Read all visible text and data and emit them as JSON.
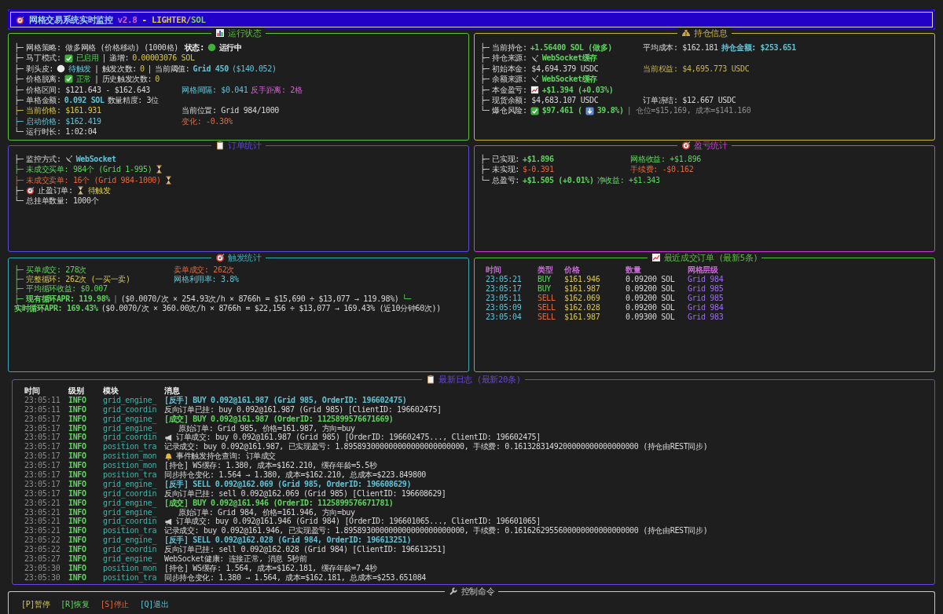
{
  "header": {
    "title": "网格交易系统实时监控",
    "version": "v2.8",
    "separator": "-",
    "exchange": "LIGHTER/",
    "symbol": "SOL"
  },
  "rows": [
    [
      {
        "kind": "tree",
        "color": "#5cbf3c",
        "title": [
          {
            "kind": "bar-chart-icon"
          },
          {
            "kind": "title",
            "text": "运行状态"
          }
        ],
        "lines": [
          {
            "branch": "├─",
            "cells": [
              [
                {
                  "kind": "label",
                  "text": "网格策略: 做多网格 (价格移动) (1000格)"
                }
              ],
              [
                {
                  "kind": "bold",
                  "text": "状态:"
                },
                {
                  "kind": "status-light-icon"
                },
                {
                  "kind": "bold",
                  "text": "运行中"
                }
              ]
            ]
          },
          {
            "branch": "├─",
            "cells": [
              [
                {
                  "kind": "label",
                  "text": "马丁模式:"
                },
                {
                  "kind": "check-icon"
                },
                {
                  "kind": "green",
                  "text": "已启用"
                },
                {
                  "kind": "sep",
                  "text": "|"
                },
                {
                  "kind": "label",
                  "text": "递增:"
                },
                {
                  "kind": "yellow",
                  "text": "0.00003076 SOL"
                }
              ]
            ]
          },
          {
            "branch": "├─",
            "cells": [
              [
                {
                  "kind": "label",
                  "text": "剥头皮:"
                },
                {
                  "kind": "circle-icon"
                },
                {
                  "kind": "cyan",
                  "text": "待触发"
                },
                {
                  "kind": "sep",
                  "text": "|"
                },
                {
                  "kind": "label",
                  "text": "触发次数:"
                },
                {
                  "kind": "yellow",
                  "text": "0"
                },
                {
                  "kind": "sep",
                  "text": "|"
                },
                {
                  "kind": "label",
                  "text": "当前阈值:"
                },
                {
                  "kind": "bcyan",
                  "text": "Grid 450"
                },
                {
                  "kind": "cyan",
                  "text": "($140.052)"
                }
              ]
            ]
          },
          {
            "branch": "├─",
            "cells": [
              [
                {
                  "kind": "label",
                  "text": "价格脱离:"
                },
                {
                  "kind": "check-icon"
                },
                {
                  "kind": "green",
                  "text": "正常"
                },
                {
                  "kind": "sep",
                  "text": "|"
                },
                {
                  "kind": "label",
                  "text": "历史触发次数:"
                },
                {
                  "kind": "yellow",
                  "text": "0"
                }
              ]
            ]
          },
          {
            "branch": "├─",
            "cells": [
              [
                {
                  "kind": "label",
                  "text": "价格区间: $121.643 - $162.643"
                }
              ],
              [
                {
                  "kind": "cyan",
                  "text": "网格间隔: $0.041"
                },
                {
                  "kind": "magenta",
                  "text": "反手距离: 2格"
                }
              ]
            ]
          },
          {
            "branch": "├─",
            "cells": [
              [
                {
                  "kind": "label",
                  "text": "单格金额:"
                },
                {
                  "kind": "bcyan",
                  "text": "0.092 SOL"
                },
                {
                  "kind": "label",
                  "text": "数量精度: 3位"
                }
              ]
            ]
          },
          {
            "branch": "├─",
            "kind": "yellow",
            "cells": [
              [
                {
                  "kind": "yellow",
                  "text": "当前价格: $161.931"
                }
              ],
              [
                {
                  "kind": "label",
                  "text": "当前位置: Grid 984/1000"
                }
              ]
            ]
          },
          {
            "branch": "├─",
            "kind": "cyan",
            "cells": [
              [
                {
                  "kind": "cyan",
                  "text": "启动价格: $162.419"
                }
              ],
              [
                {
                  "kind": "orange",
                  "text": "变化: -0.30%"
                }
              ]
            ]
          },
          {
            "branch": "└─",
            "cells": [
              [
                {
                  "kind": "label",
                  "text": "运行时长: 1:02:04"
                }
              ]
            ]
          }
        ]
      },
      {
        "kind": "tree",
        "color": "#c8b43c",
        "title": [
          {
            "kind": "money-bag-icon"
          },
          {
            "kind": "title",
            "text": "持仓信息"
          }
        ],
        "lines": [
          {
            "branch": "├─",
            "cells": [
              [
                {
                  "kind": "label",
                  "text": "当前持仓:"
                },
                {
                  "kind": "bgreen",
                  "text": "+1.56400 SOL (做多)"
                }
              ],
              [
                {
                  "kind": "label",
                  "text": "平均成本: $162.181"
                },
                {
                  "kind": "bcyan",
                  "text": "持仓金额: $253.651"
                }
              ]
            ]
          },
          {
            "branch": "├─",
            "cells": [
              [
                {
                  "kind": "label",
                  "text": "持仓来源:"
                },
                {
                  "kind": "satellite-dish-icon"
                },
                {
                  "kind": "bgreen",
                  "text": "WebSocket缓存"
                }
              ]
            ]
          },
          {
            "branch": "├─",
            "cells": [
              [
                {
                  "kind": "label",
                  "text": "初始本金: $4,694.379 USDC"
                }
              ],
              [
                {
                  "kind": "olive",
                  "text": "当前权益: $4,695.773 USDC"
                }
              ]
            ]
          },
          {
            "branch": "├─",
            "cells": [
              [
                {
                  "kind": "label",
                  "text": "余额来源:"
                },
                {
                  "kind": "satellite-dish-icon"
                },
                {
                  "kind": "bgreen",
                  "text": "WebSocket缓存"
                }
              ]
            ]
          },
          {
            "branch": "├─",
            "cells": [
              [
                {
                  "kind": "label",
                  "text": "本金盈亏:"
                },
                {
                  "kind": "line-chart-icon"
                },
                {
                  "kind": "bgreen",
                  "text": "+$1.394 (+0.03%)"
                }
              ]
            ]
          },
          {
            "branch": "├─",
            "cells": [
              [
                {
                  "kind": "label",
                  "text": "现货余额: $4,683.107 USDC"
                }
              ],
              [
                {
                  "kind": "label",
                  "text": "订单冻结: $12.667 USDC"
                }
              ]
            ]
          },
          {
            "branch": "└─",
            "cells": [
              [
                {
                  "kind": "label",
                  "text": "爆仓风险:"
                },
                {
                  "kind": "check-icon"
                },
                {
                  "kind": "bgreen",
                  "text": "$97.461 ("
                },
                {
                  "kind": "down-arrow-icon"
                },
                {
                  "kind": "bgreen",
                  "text": "39.8%)"
                },
                {
                  "kind": "gray",
                  "text": "| 仓位=$15,169, 成本=$141.160"
                }
              ]
            ]
          }
        ]
      }
    ],
    [
      {
        "kind": "tree",
        "color": "#5a4bd6",
        "title": [
          {
            "kind": "clipboard-icon"
          },
          {
            "kind": "title",
            "text": "订单统计"
          }
        ],
        "lines": [
          {
            "branch": "├─",
            "cells": [
              [
                {
                  "kind": "label",
                  "text": "监控方式:"
                },
                {
                  "kind": "satellite-dish-icon"
                },
                {
                  "kind": "bcyan",
                  "text": "WebSocket"
                }
              ]
            ]
          },
          {
            "branch": "├─",
            "kind": "green",
            "cells": [
              [
                {
                  "kind": "green",
                  "text": "未成交买单: 984个 (Grid 1-995)"
                },
                {
                  "kind": "hourglass-icon"
                }
              ]
            ]
          },
          {
            "branch": "├─",
            "kind": "orange",
            "cells": [
              [
                {
                  "kind": "orange",
                  "text": "未成交卖单: 16个 (Grid 984-1000)"
                },
                {
                  "kind": "hourglass-icon"
                }
              ]
            ]
          },
          {
            "branch": "├─",
            "cells": [
              [
                {
                  "kind": "target-icon"
                },
                {
                  "kind": "label",
                  "text": "止盈订单:"
                },
                {
                  "kind": "hourglass-icon"
                },
                {
                  "kind": "yellow",
                  "text": "待触发"
                }
              ]
            ]
          },
          {
            "branch": "└─",
            "cells": [
              [
                {
                  "kind": "label",
                  "text": "总挂单数量: 1000个"
                }
              ]
            ]
          }
        ]
      },
      {
        "kind": "tree",
        "color": "#c040c8",
        "title": [
          {
            "kind": "target-icon"
          },
          {
            "kind": "title",
            "text": "盈亏统计"
          }
        ],
        "lines": [
          {
            "branch": "├─",
            "cells": [
              [
                {
                  "kind": "label",
                  "text": "已实现:"
                },
                {
                  "kind": "bgreen",
                  "text": "+$1.896"
                }
              ],
              [
                {
                  "kind": "green",
                  "text": "网格收益: +$1.896"
                }
              ]
            ]
          },
          {
            "branch": "├─",
            "cells": [
              [
                {
                  "kind": "label",
                  "text": "未实现:"
                },
                {
                  "kind": "orange",
                  "text": "$-0.391"
                }
              ],
              [
                {
                  "kind": "orange",
                  "text": "手续费: -$0.162"
                }
              ]
            ]
          },
          {
            "branch": "└─",
            "cells": [
              [
                {
                  "kind": "label",
                  "text": "总盈亏:"
                },
                {
                  "kind": "bgreen",
                  "text": "+$1.505 (+0.01%)"
                },
                {
                  "kind": "green",
                  "text": "净收益: +$1.343"
                }
              ]
            ]
          }
        ]
      }
    ],
    [
      {
        "kind": "tree",
        "color": "#3ca8b8",
        "title": [
          {
            "kind": "target-icon"
          },
          {
            "kind": "title",
            "text": "触发统计"
          }
        ],
        "lines": [
          {
            "branch": "├─",
            "kind": "green",
            "cells": [
              [
                {
                  "kind": "green",
                  "text": "买单成交: 278次"
                }
              ],
              [
                {
                  "kind": "orange",
                  "text": "卖单成交: 262次"
                }
              ]
            ]
          },
          {
            "branch": "├─",
            "kind": "green",
            "cells": [
              [
                {
                  "kind": "yellow",
                  "text": "完整循环: 262次 (一买一卖)"
                }
              ],
              [
                {
                  "kind": "cyan",
                  "text": "网格利用率: 3.8%"
                }
              ]
            ]
          },
          {
            "branch": "├─",
            "kind": "green",
            "cells": [
              [
                {
                  "kind": "green",
                  "text": "平均循环收益: $0.007"
                }
              ]
            ]
          },
          {
            "branch": "├─",
            "kind": "green",
            "cells": [
              [
                {
                  "kind": "bgreen",
                  "text": "现有循环APR: 119.98%"
                },
                {
                  "kind": "gray",
                  "text": "|"
                },
                {
                  "kind": "label",
                  "text": "($0.0070/次 × 254.93次/h × 8766h = $15,690 ÷ $13,077 → 119.98%)"
                },
                {
                  "kind": "green",
                  "text": "└─"
                }
              ]
            ]
          },
          {
            "cells": [
              [
                {
                  "kind": "bgreen",
                  "text": "实时循环APR: 169.43%"
                },
                {
                  "kind": "label",
                  "text": "($0.0070/次 × 360.00次/h × 8766h = $22,156 ÷ $13,077 → 169.43% (近10分钟60次))"
                }
              ]
            ]
          }
        ]
      },
      {
        "kind": "trades",
        "color": "#5cbf3c",
        "title": [
          {
            "kind": "line-chart-icon"
          },
          {
            "kind": "title",
            "text": "最近成交订单 (最新5条)"
          }
        ],
        "columns": [
          "时间",
          "类型",
          "价格",
          "数量",
          "网格层级"
        ],
        "rows": [
          {
            "time": "23:05:21",
            "kind": "buy",
            "type": "BUY",
            "price": "$161.946",
            "qty": "0.09200 SOL",
            "level": "Grid 984"
          },
          {
            "time": "23:05:17",
            "kind": "buy",
            "type": "BUY",
            "price": "$161.987",
            "qty": "0.09200 SOL",
            "level": "Grid 985"
          },
          {
            "time": "23:05:11",
            "kind": "sell",
            "type": "SELL",
            "price": "$162.069",
            "qty": "0.09200 SOL",
            "level": "Grid 985"
          },
          {
            "time": "23:05:09",
            "kind": "sell",
            "type": "SELL",
            "price": "$162.028",
            "qty": "0.09200 SOL",
            "level": "Grid 984"
          },
          {
            "time": "23:05:04",
            "kind": "sell",
            "type": "SELL",
            "price": "$161.987",
            "qty": "0.09300 SOL",
            "level": "Grid 983"
          }
        ]
      }
    ],
    [
      {
        "kind": "log",
        "color": "#6a46d8",
        "title": [
          {
            "kind": "clipboard-icon"
          },
          {
            "kind": "title",
            "text": "最新日志 (最新20条)"
          }
        ],
        "columns": [
          "时间",
          "级别",
          "模块",
          "消息"
        ],
        "rows": [
          {
            "time": "23:05:11",
            "level": "INFO",
            "module": "grid_engine_",
            "kind": "reverse",
            "message": "[反手] BUY 0.092@161.987 (Grid 985, OrderID: 196602475)"
          },
          {
            "time": "23:05:11",
            "level": "INFO",
            "module": "grid_coordin",
            "kind": "plain",
            "message": "反向订单已挂: buy 0.092@161.987 (Grid 985) [ClientID: 196602475]"
          },
          {
            "time": "23:05:17",
            "level": "INFO",
            "module": "grid_engine_",
            "kind": "fill",
            "message": "[成交] BUY 0.092@161.987 (OrderID: 1125899576671669)"
          },
          {
            "time": "23:05:17",
            "level": "INFO",
            "module": "grid_engine_",
            "kind": "detail",
            "message": "原始订单: Grid 985, 价格=161.987, 方向=buy"
          },
          {
            "time": "23:05:17",
            "level": "INFO",
            "module": "grid_coordin",
            "kind": "notice",
            "message": "订单成交: buy 0.092@161.987 (Grid 985) [OrderID: 196602475..., ClientID: 196602475]"
          },
          {
            "time": "23:05:17",
            "level": "INFO",
            "module": "position_tra",
            "kind": "plain",
            "message": "记录成交: buy 0.092@161.987, 已实现盈亏: 1.895893000000000000000000000, 手续费: 0.1613283149200000000000000000 (持仓由REST同步)"
          },
          {
            "time": "23:05:17",
            "level": "INFO",
            "module": "position_mon",
            "kind": "alert",
            "message": "事件触发持仓查询: 订单成交"
          },
          {
            "time": "23:05:17",
            "level": "INFO",
            "module": "position_mon",
            "kind": "plain",
            "message": "[持仓] WS缓存: 1.380, 成本=$162.210, 缓存年龄=5.5秒"
          },
          {
            "time": "23:05:17",
            "level": "INFO",
            "module": "position_tra",
            "kind": "plain",
            "message": "同步持仓变化: 1.564 → 1.380, 成本=$162.210, 总成本=$223.849800"
          },
          {
            "time": "23:05:17",
            "level": "INFO",
            "module": "grid_engine_",
            "kind": "reverse",
            "message": "[反手] SELL 0.092@162.069 (Grid 985, OrderID: 196608629)"
          },
          {
            "time": "23:05:17",
            "level": "INFO",
            "module": "grid_coordin",
            "kind": "plain",
            "message": "反向订单已挂: sell 0.092@162.069 (Grid 985) [ClientID: 196608629]"
          },
          {
            "time": "23:05:21",
            "level": "INFO",
            "module": "grid_engine_",
            "kind": "fill",
            "message": "[成交] BUY 0.092@161.946 (OrderID: 1125899576671781)"
          },
          {
            "time": "23:05:21",
            "level": "INFO",
            "module": "grid_engine_",
            "kind": "detail",
            "message": "原始订单: Grid 984, 价格=161.946, 方向=buy"
          },
          {
            "time": "23:05:21",
            "level": "INFO",
            "module": "grid_coordin",
            "kind": "notice",
            "message": "订单成交: buy 0.092@161.946 (Grid 984) [OrderID: 196601065..., ClientID: 196601065]"
          },
          {
            "time": "23:05:21",
            "level": "INFO",
            "module": "position_tra",
            "kind": "plain",
            "message": "记录成交: buy 0.092@161.946, 已实现盈亏: 1.895893000000000000000000000, 手续费: 0.1616262955600000000000000000 (持仓由REST同步)"
          },
          {
            "time": "23:05:22",
            "level": "INFO",
            "module": "grid_engine_",
            "kind": "reverse",
            "message": "[反手] SELL 0.092@162.028 (Grid 984, OrderID: 196613251)"
          },
          {
            "time": "23:05:22",
            "level": "INFO",
            "module": "grid_coordin",
            "kind": "plain",
            "message": "反向订单已挂: sell 0.092@162.028 (Grid 984) [ClientID: 196613251]"
          },
          {
            "time": "23:05:27",
            "level": "INFO",
            "module": "grid_engine_",
            "kind": "plain",
            "message": "WebSocket健康: 连接正常, 消息 5秒前"
          },
          {
            "time": "23:05:30",
            "level": "INFO",
            "module": "position_mon",
            "kind": "plain",
            "message": "[持仓] WS缓存: 1.564, 成本=$162.181, 缓存年龄=7.4秒"
          },
          {
            "time": "23:05:30",
            "level": "INFO",
            "module": "position_tra",
            "kind": "plain",
            "message": "同步持仓变化: 1.380 → 1.564, 成本=$162.181, 总成本=$253.651084"
          }
        ]
      }
    ],
    [
      {
        "kind": "commands",
        "color": "#c8c8c8",
        "title": [
          {
            "kind": "wrench-icon"
          },
          {
            "kind": "title",
            "text": "控制命令"
          }
        ],
        "commands": [
          {
            "kind": "pause",
            "text": "[P]暂停"
          },
          {
            "kind": "resume",
            "text": "[R]恢复"
          },
          {
            "kind": "stop",
            "text": "[S]停止"
          },
          {
            "kind": "quit",
            "text": "[Q]退出"
          }
        ]
      }
    ]
  ]
}
